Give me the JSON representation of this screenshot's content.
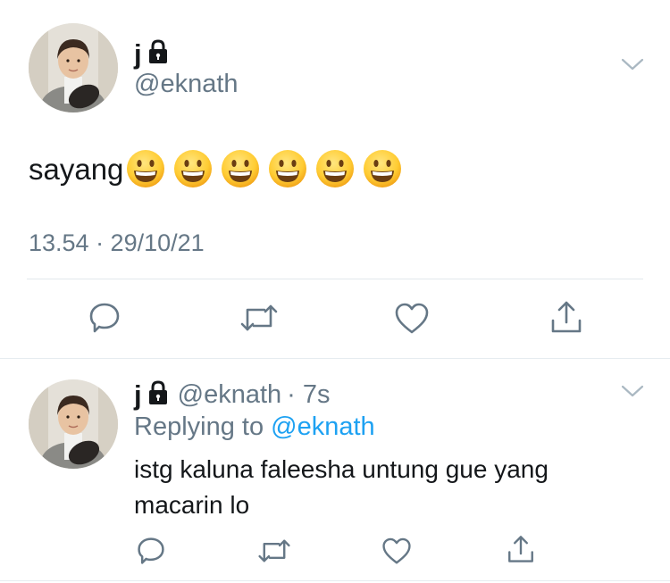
{
  "main_tweet": {
    "name": "j",
    "handle": "@eknath",
    "text": "sayang",
    "emoji_count": 6,
    "emoji_name": "grinning-face",
    "timestamp": "13.54 · 29/10/21",
    "actions": [
      "reply-icon",
      "retweet-icon",
      "like-icon",
      "share-icon"
    ]
  },
  "reply": {
    "name": "j",
    "handle": "@eknath",
    "time": "· 7s",
    "replying_prefix": "Replying to",
    "replying_to": "@eknath",
    "text_line1": "istg kaluna faleesha untung gue yang",
    "text_line2": "macarin lo",
    "actions": [
      "reply-icon",
      "retweet-icon",
      "like-icon",
      "share-icon"
    ]
  },
  "colors": {
    "text": "#14171a",
    "secondary": "#657786",
    "accent": "#1da1f2",
    "divider": "#e1e8ed",
    "icon": "#657786"
  }
}
